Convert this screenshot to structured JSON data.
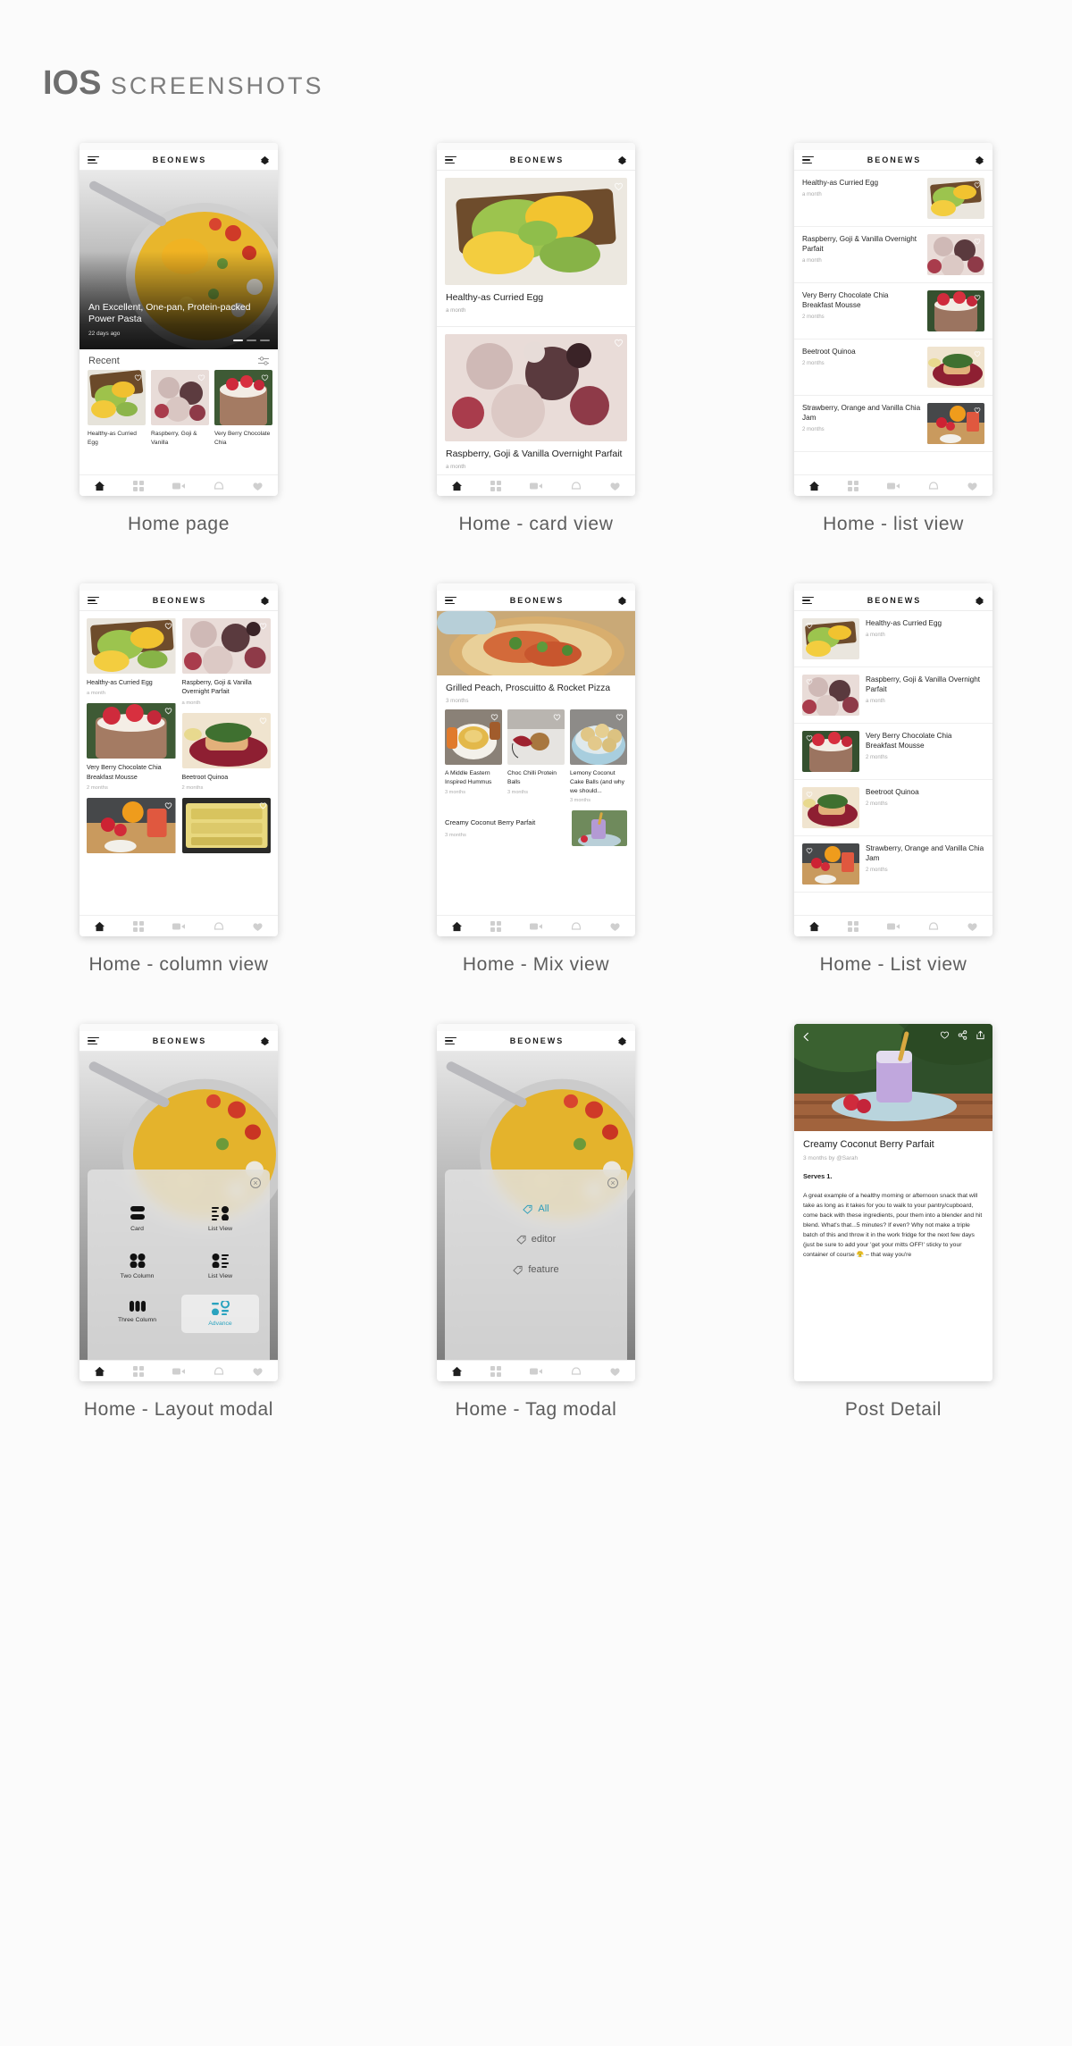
{
  "page": {
    "title_bold": "IOS",
    "title_light": "SCREENSHOTS"
  },
  "app": {
    "brand": "BEONEWS",
    "menu_icon": "hamburger-icon",
    "diamond_icon": "diamond-icon"
  },
  "tabbar": {
    "items": [
      "home-icon",
      "grid-icon",
      "video-icon",
      "bell-icon",
      "heart-icon"
    ]
  },
  "screens": [
    {
      "caption": "Home page",
      "hero": {
        "title": "An Excellent, One-pan, Protein-packed Power Pasta",
        "date": "22 days ago",
        "dots": 3,
        "active_dot": 0
      },
      "section": {
        "title": "Recent",
        "filter_icon": "sliders-icon"
      },
      "recent": [
        {
          "title": "Healthy-as Curried Egg"
        },
        {
          "title": "Raspberry, Goji & Vanilla"
        },
        {
          "title": "Very Berry Chocolate Chia"
        }
      ]
    },
    {
      "caption": "Home - card view",
      "cards": [
        {
          "title": "Healthy-as Curried Egg",
          "date": "a month"
        },
        {
          "title": "Raspberry, Goji & Vanilla Overnight Parfait",
          "date": "a month"
        }
      ]
    },
    {
      "caption": "Home - list view",
      "rows": [
        {
          "title": "Healthy-as Curried Egg",
          "date": "a month"
        },
        {
          "title": "Raspberry, Goji & Vanilla Overnight Parfait",
          "date": "a month"
        },
        {
          "title": "Very Berry Chocolate Chia Breakfast Mousse",
          "date": "2 months"
        },
        {
          "title": "Beetroot Quinoa",
          "date": "2 months"
        },
        {
          "title": "Strawberry, Orange and Vanilla Chia Jam",
          "date": "2 months"
        }
      ]
    },
    {
      "caption": "Home - column view",
      "left": [
        {
          "title": "Healthy-as Curried Egg",
          "date": "a month"
        },
        {
          "title": "Very Berry Chocolate Chia Breakfast Mousse",
          "date": "2 months"
        },
        {
          "title": "",
          "date": ""
        }
      ],
      "right": [
        {
          "title": "Raspberry, Goji & Vanilla Overnight Parfait",
          "date": "a month"
        },
        {
          "title": "Beetroot Quinoa",
          "date": "2 months"
        },
        {
          "title": "",
          "date": ""
        }
      ]
    },
    {
      "caption": "Home - Mix view",
      "feature": {
        "title": "Grilled Peach, Proscuitto & Rocket Pizza",
        "date": "3 months"
      },
      "triple": [
        {
          "title": "A Middle Eastern Inspired Hummus",
          "date": "3 months"
        },
        {
          "title": "Choc Chilli Protein Balls",
          "date": "3 months"
        },
        {
          "title": "Lemony Coconut Cake Balls (and why we should...",
          "date": "3 months"
        }
      ],
      "last": {
        "title": "Creamy Coconut Berry Parfait",
        "date": "3 months"
      }
    },
    {
      "caption": "Home - List view",
      "rows": [
        {
          "title": "Healthy-as Curried Egg",
          "date": "a month"
        },
        {
          "title": "Raspberry, Goji & Vanilla Overnight Parfait",
          "date": "a month"
        },
        {
          "title": "Very Berry Chocolate Chia Breakfast Mousse",
          "date": "2 months"
        },
        {
          "title": "Beetroot Quinoa",
          "date": "2 months"
        },
        {
          "title": "Strawberry, Orange and Vanilla Chia Jam",
          "date": "2 months"
        }
      ]
    },
    {
      "caption": "Home - Layout modal",
      "modal": {
        "close_icon": "close-circle-icon",
        "options": [
          {
            "label": "Card",
            "icon": "card-layout-icon",
            "selected": false
          },
          {
            "label": "List View",
            "icon": "list-right-icon",
            "selected": false
          },
          {
            "label": "Two Column",
            "icon": "two-column-icon",
            "selected": false
          },
          {
            "label": "List View",
            "icon": "list-left-icon",
            "selected": false
          },
          {
            "label": "Three Column",
            "icon": "three-column-icon",
            "selected": false
          },
          {
            "label": "Advance",
            "icon": "advance-layout-icon",
            "selected": true
          }
        ],
        "accent": "#2aa3bf"
      }
    },
    {
      "caption": "Home - Tag modal",
      "modal": {
        "close_icon": "close-circle-icon",
        "tags": [
          {
            "label": "All",
            "selected": true
          },
          {
            "label": "editor",
            "selected": false
          },
          {
            "label": "feature",
            "selected": false
          }
        ],
        "accent": "#2a9dbb"
      }
    },
    {
      "caption": "Post Detail",
      "actions": [
        "back-icon",
        "heart-icon",
        "share-icon",
        "export-icon"
      ],
      "title": "Creamy Coconut Berry Parfait",
      "meta": "3 months by @Sarah",
      "serves": "Serves 1.",
      "body": "A great example of a healthy morning or afternoon snack that will take as long as it takes for you to walk to your pantry/cupboard, come back with these ingredients, pour them into a blender and hit blend. What's that...5 minutes? If even? Why not make a triple batch of this and throw it in the work fridge for the next few days (just be sure to add your 'get your mitts OFF!' sticky to your container of course 😤 – that way you're"
    }
  ]
}
